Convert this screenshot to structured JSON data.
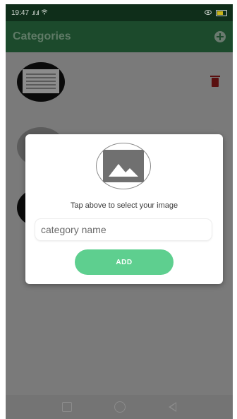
{
  "status_bar": {
    "time": "19:47",
    "signal_text": ".ıl .ıl",
    "wifi_icon": "wifi-icon",
    "battery_icon": "battery-icon"
  },
  "app_bar": {
    "title": "Categories",
    "add_icon": "add-circle-icon"
  },
  "list": {
    "delete_icon": "delete-icon"
  },
  "dialog": {
    "image_placeholder_icon": "image-icon",
    "hint": "Tap above to select your image",
    "input_placeholder": "category name",
    "input_value": "",
    "add_label": "ADD"
  },
  "nav_bar": {
    "icons": [
      "square-icon",
      "home-circle-icon",
      "back-triangle-icon"
    ]
  },
  "colors": {
    "status_bar": "#0f2e1a",
    "app_bar": "#1c4a2c",
    "accent": "#5ecf8f",
    "delete": "#b71c1c"
  }
}
